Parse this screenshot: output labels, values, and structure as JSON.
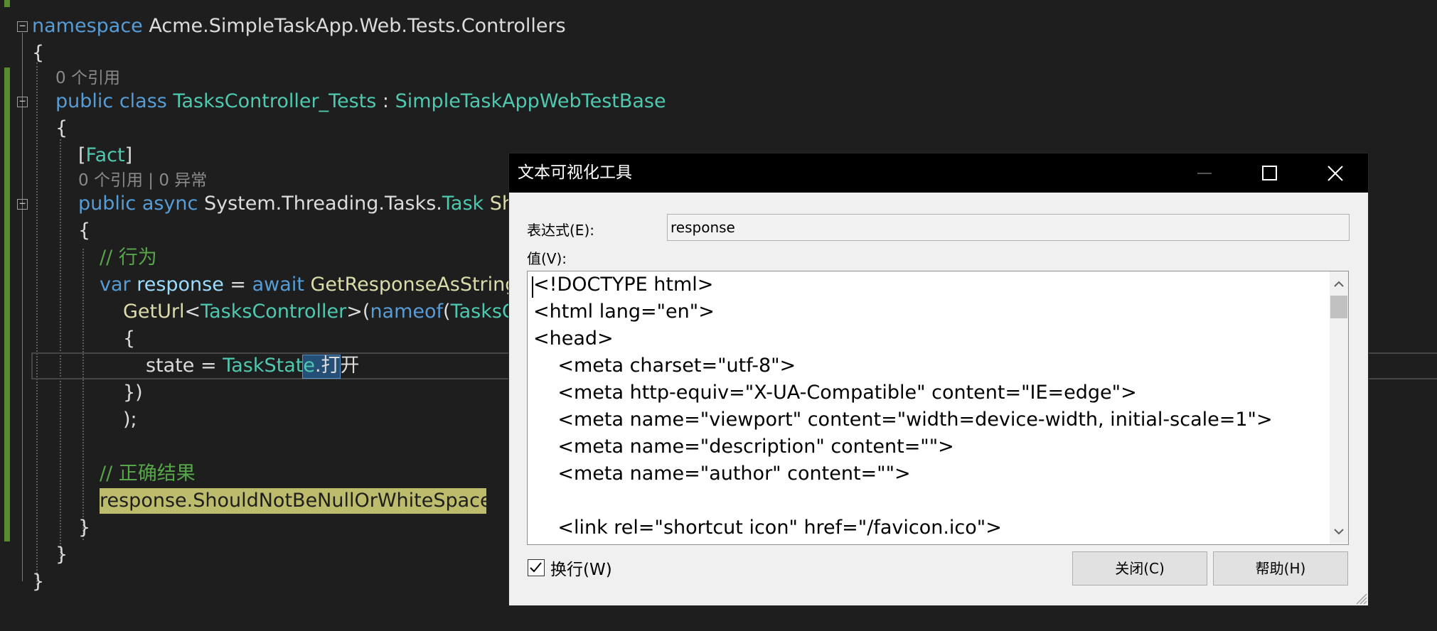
{
  "editor": {
    "lines": {
      "l1": {
        "kw": "namespace",
        "name": " Acme.SimpleTaskApp.Web.Tests.Controllers"
      },
      "l2": {
        "text": "{"
      },
      "l3": {
        "refs": "0 个引用"
      },
      "l4": {
        "kw": "public class",
        "cls": "TasksController_Tests",
        "sep": " : ",
        "base": "SimpleTaskAppWebTestBase"
      },
      "l5": {
        "text": "{"
      },
      "l6": {
        "open": "[",
        "attr": "Fact",
        "close": "]"
      },
      "l7": {
        "refs": "0 个引用 | 0 异常"
      },
      "l8": {
        "kw": "public async",
        "ns": " System.Threading.Tasks.",
        "type": "Task",
        "method": " Should"
      },
      "l9": {
        "text": "{"
      },
      "l10": {
        "comment": "// 行为"
      },
      "l11": {
        "kw": "var",
        "var": " response",
        "eq": " = ",
        "kw2": "await",
        "call": " GetResponseAsStringAsy"
      },
      "l12": {
        "call": "GetUrl",
        "lt": "<",
        "type": "TasksController",
        "gt": ">(",
        "kw": "nameof",
        "paren": "(",
        "type2": "TasksCon"
      },
      "l13": {
        "text": "{"
      },
      "l14": {
        "prop": "state",
        "eq": " = ",
        "type": "TaskState",
        "dot": ".",
        "sel": "打开"
      },
      "l15": {
        "text": "})"
      },
      "l16": {
        "text": ");"
      },
      "l17": {
        "comment": "// 正确结果"
      },
      "l18": {
        "stmt": "response.ShouldNotBeNullOrWhiteSpace();"
      },
      "l19": {
        "text": "}"
      },
      "l20": {
        "text": "}"
      },
      "l21": {
        "text": "}"
      }
    }
  },
  "dialog": {
    "title": "文本可视化工具",
    "expression_label": "表达式(E):",
    "expression_value": "response",
    "value_label": "值(V):",
    "value_lines": [
      "<!DOCTYPE html>",
      "<html lang=\"en\">",
      "<head>",
      "    <meta charset=\"utf-8\">",
      "    <meta http-equiv=\"X-UA-Compatible\" content=\"IE=edge\">",
      "    <meta name=\"viewport\" content=\"width=device-width, initial-scale=1\">",
      "    <meta name=\"description\" content=\"\">",
      "    <meta name=\"author\" content=\"\">",
      "",
      "    <link rel=\"shortcut icon\" href=\"/favicon.ico\">"
    ],
    "wrap_label": "换行(W)",
    "wrap_checked": true,
    "close_label": "关闭(C)",
    "help_label": "帮助(H)"
  }
}
